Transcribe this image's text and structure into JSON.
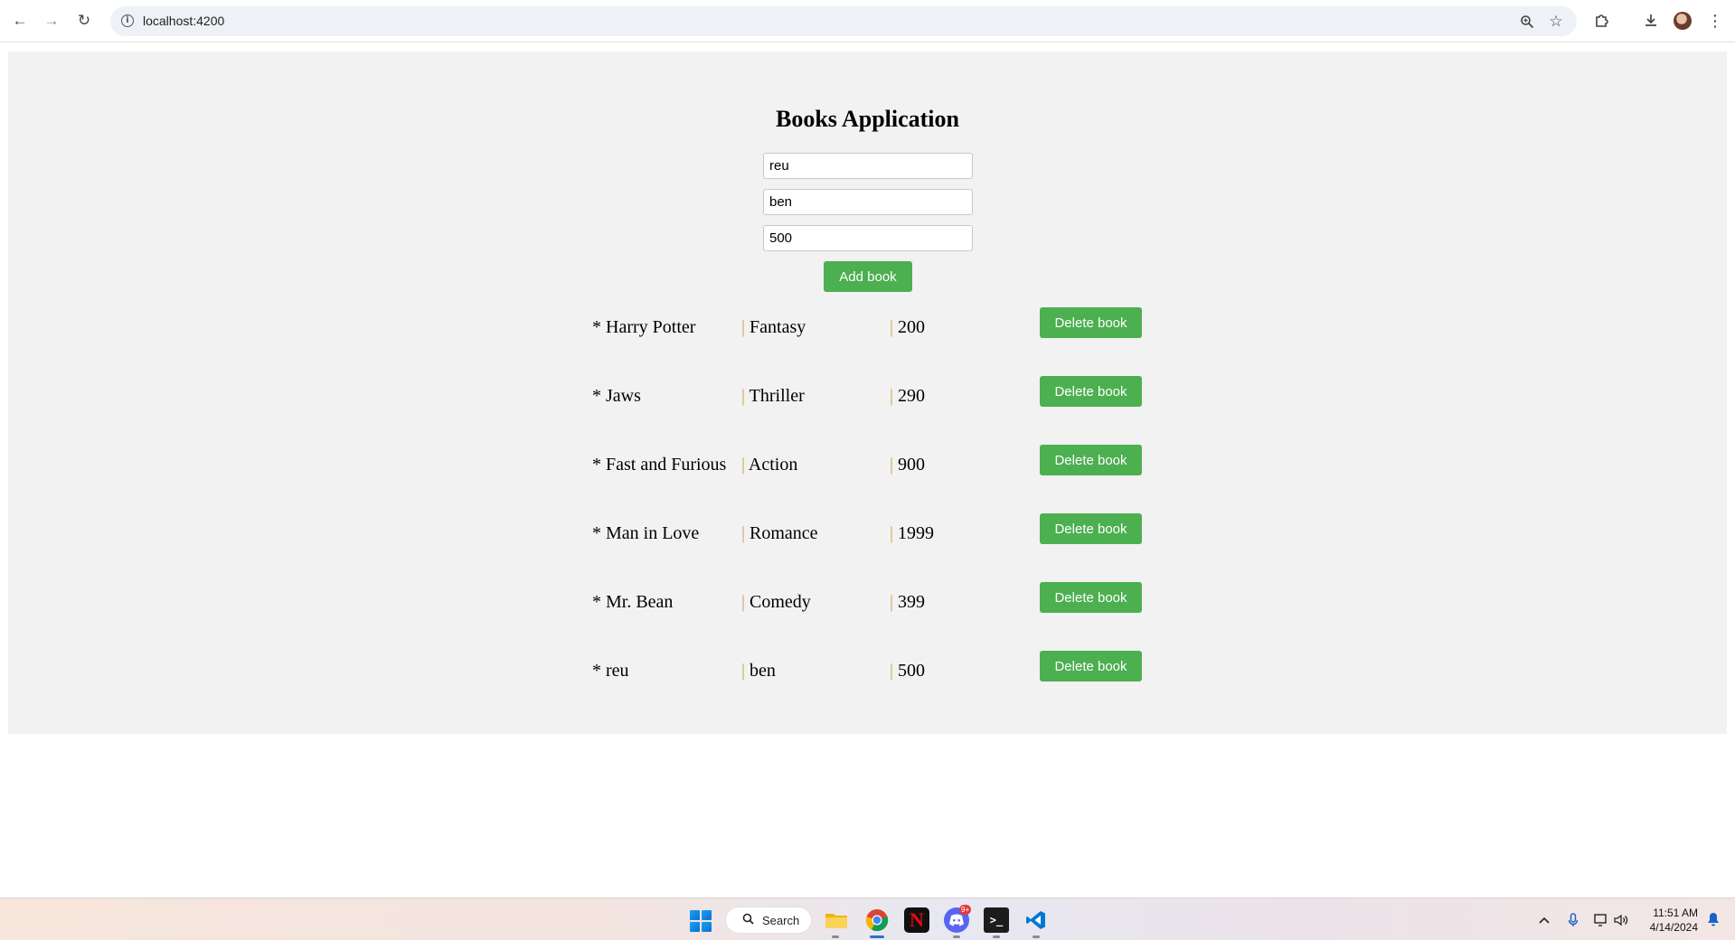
{
  "browser": {
    "url": "localhost:4200",
    "back_icon": "arrow-left-icon",
    "forward_icon": "arrow-right-icon",
    "reload_icon": "reload-icon"
  },
  "app": {
    "title": "Books Application",
    "form": {
      "title_value": "reu",
      "genre_value": "ben",
      "price_value": "500",
      "add_label": "Add book"
    },
    "books": [
      {
        "title": "* Harry Potter",
        "genre": "Fantasy",
        "price": "200",
        "delete_label": "Delete book"
      },
      {
        "title": "* Jaws",
        "genre": "Thriller",
        "price": "290",
        "delete_label": "Delete book"
      },
      {
        "title": "* Fast and Furious",
        "genre": "Action",
        "price": "900",
        "delete_label": "Delete book"
      },
      {
        "title": "* Man in Love",
        "genre": "Romance",
        "price": "1999",
        "delete_label": "Delete book"
      },
      {
        "title": "* Mr. Bean",
        "genre": "Comedy",
        "price": "399",
        "delete_label": "Delete book"
      },
      {
        "title": "* reu",
        "genre": "ben",
        "price": "500",
        "delete_label": "Delete book"
      }
    ],
    "separator": "|",
    "button_color": "#4caf50",
    "separator_color": "#c8a24a"
  },
  "taskbar": {
    "search_label": "Search",
    "time": "11:51 AM",
    "date": "4/14/2024",
    "discord_badge": "9+"
  }
}
